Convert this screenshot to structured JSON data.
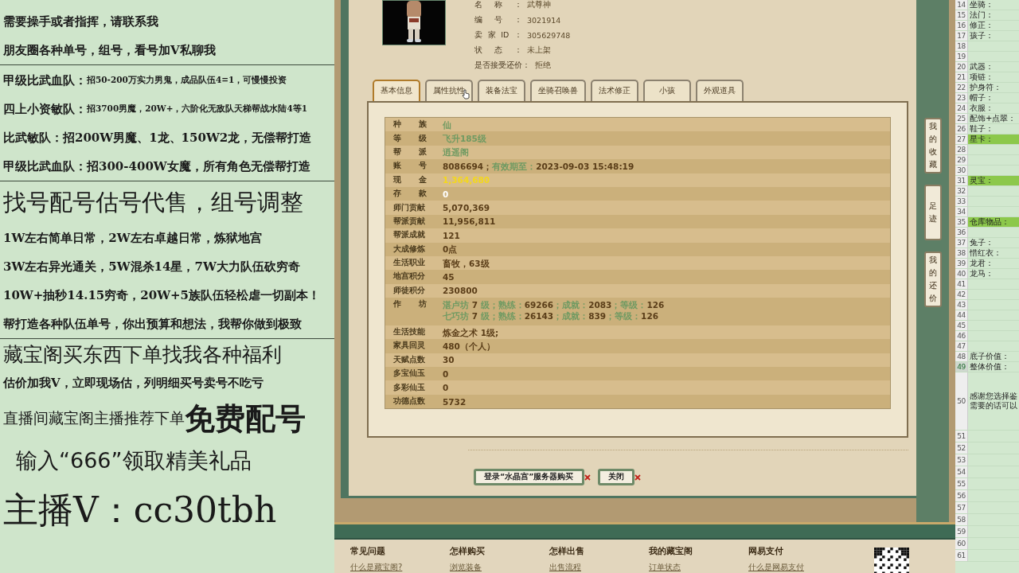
{
  "left_panel": {
    "lines": [
      {
        "kind": "line",
        "text": "需要操手或者指挥，请联系我"
      },
      {
        "kind": "line",
        "text": "朋友圈各种单号，组号，看号加V私聊我"
      },
      {
        "kind": "divider"
      },
      {
        "kind": "split",
        "label": "甲级比武血队：",
        "text": "招50-200万实力男鬼，成品队伍4=1，可慢慢投资"
      },
      {
        "kind": "split",
        "label": "四上小资敏队：",
        "text": "招3700男魔，20W+，六阶化无敌队天梯帮战水陆4等1"
      },
      {
        "kind": "line",
        "text": "比武敏队：招200W男魔、1龙、150W2龙，无偿帮打造"
      },
      {
        "kind": "line",
        "text": "甲级比武血队：招300-400W女魔，所有角色无偿帮打造"
      },
      {
        "kind": "divider"
      },
      {
        "kind": "headline",
        "text": "找号配号估号代售，组号调整"
      },
      {
        "kind": "line",
        "text": "1W左右简单日常，2W左右卓越日常，炼狱地宫"
      },
      {
        "kind": "line",
        "text": "3W左右异光通关，5W混杀14星，7W大力队伍砍穷奇"
      },
      {
        "kind": "line",
        "text": "10W+抽秒14.15穷奇，20W+5族队伍轻松虐一切副本！"
      },
      {
        "kind": "line",
        "text": "帮打造各种队伍单号，你出预算和想法，我帮你做到极致"
      },
      {
        "kind": "divider"
      },
      {
        "kind": "subhead",
        "text": "藏宝阁买东西下单找我各种福利"
      },
      {
        "kind": "line",
        "text": "估价加我V，立即现场估，列明细买号卖号不吃亏"
      },
      {
        "kind": "promo",
        "text": "直播间藏宝阁主播推荐下单",
        "suffix": "免费配号"
      },
      {
        "kind": "gift",
        "text": "输入“666”领取精美礼品"
      },
      {
        "kind": "contact",
        "text": "主播V：cc30tbh"
      }
    ]
  },
  "item": {
    "info": [
      {
        "label": "名称：",
        "value": "武尊神"
      },
      {
        "label": "编号：",
        "value": "3021914"
      },
      {
        "label": "卖家ID：",
        "value": "305629748"
      },
      {
        "label": "状态：",
        "value": "未上架"
      },
      {
        "label": "是否接受还价：",
        "value": "拒绝"
      }
    ],
    "tabs": [
      {
        "label": "基本信息",
        "selected": true
      },
      {
        "label": "属性抗性",
        "selected": false
      },
      {
        "label": "装备法宝",
        "selected": false
      },
      {
        "label": "坐骑召唤兽",
        "selected": false
      },
      {
        "label": "法术修正",
        "selected": false
      },
      {
        "label": "小孩",
        "selected": false
      },
      {
        "label": "外观道具",
        "selected": false
      }
    ],
    "details": [
      {
        "label": "种族",
        "lines": [
          [
            {
              "color": "#6f9a62",
              "text": "仙"
            }
          ]
        ]
      },
      {
        "label": "等级",
        "lines": [
          [
            {
              "color": "#6f9a62",
              "text": "飞升185级"
            }
          ]
        ]
      },
      {
        "label": "帮派",
        "lines": [
          [
            {
              "color": "#6f9a62",
              "text": "逍遥阁"
            }
          ]
        ]
      },
      {
        "label": "账号",
        "lines": [
          [
            {
              "color": "#5a3d18",
              "text": "8086694；"
            },
            {
              "color": "#6f9a62",
              "text": "有效期至："
            },
            {
              "color": "#5a3d18",
              "text": "2023-09-03 15:48:19"
            }
          ]
        ]
      },
      {
        "label": "现金",
        "lines": [
          [
            {
              "color": "#f4d81c",
              "text": "1,364,680"
            }
          ]
        ]
      },
      {
        "label": "存款",
        "lines": [
          [
            {
              "color": "#ffffff",
              "text": "0"
            }
          ]
        ]
      },
      {
        "label": "师门贡献",
        "lines": [
          [
            {
              "color": "#5a3d18",
              "text": "5,070,369"
            }
          ]
        ]
      },
      {
        "label": "帮派贡献",
        "lines": [
          [
            {
              "color": "#5a3d18",
              "text": "11,956,811"
            }
          ]
        ]
      },
      {
        "label": "帮派成就",
        "lines": [
          [
            {
              "color": "#5a3d18",
              "text": "121"
            }
          ]
        ]
      },
      {
        "label": "大成修炼",
        "lines": [
          [
            {
              "color": "#5a3d18",
              "text": "0点"
            }
          ]
        ]
      },
      {
        "label": "生活职业",
        "lines": [
          [
            {
              "color": "#5a3d18",
              "text": "畜牧，63级"
            }
          ]
        ]
      },
      {
        "label": "地宫积分",
        "lines": [
          [
            {
              "color": "#5a3d18",
              "text": "45"
            }
          ]
        ]
      },
      {
        "label": "师徒积分",
        "lines": [
          [
            {
              "color": "#5a3d18",
              "text": "230800"
            }
          ]
        ]
      },
      {
        "label": "作坊",
        "lines": [
          [
            {
              "color": "#6f9a62",
              "text": "湛卢坊 "
            },
            {
              "color": "#5a3d18",
              "text": "7"
            },
            {
              "color": "#6f9a62",
              "text": " 级；熟练："
            },
            {
              "color": "#5a3d18",
              "text": "69266"
            },
            {
              "color": "#6f9a62",
              "text": "；成就："
            },
            {
              "color": "#5a3d18",
              "text": "2083"
            },
            {
              "color": "#6f9a62",
              "text": "；等级："
            },
            {
              "color": "#5a3d18",
              "text": "126"
            }
          ],
          [
            {
              "color": "#6f9a62",
              "text": "七巧坊 "
            },
            {
              "color": "#5a3d18",
              "text": "7"
            },
            {
              "color": "#6f9a62",
              "text": " 级；熟练："
            },
            {
              "color": "#5a3d18",
              "text": "26143"
            },
            {
              "color": "#6f9a62",
              "text": "；成就："
            },
            {
              "color": "#5a3d18",
              "text": "839"
            },
            {
              "color": "#6f9a62",
              "text": "；等级："
            },
            {
              "color": "#5a3d18",
              "text": "126"
            }
          ]
        ]
      },
      {
        "label": "生活技能",
        "lines": [
          [
            {
              "color": "#5a3d18",
              "text": "炼金之术 1级;"
            }
          ]
        ]
      },
      {
        "label": "家具回灵",
        "lines": [
          [
            {
              "color": "#5a3d18",
              "text": "480（个人）"
            }
          ]
        ]
      },
      {
        "label": "天赋点数",
        "lines": [
          [
            {
              "color": "#5a3d18",
              "text": "30"
            }
          ]
        ]
      },
      {
        "label": "多宝仙玉",
        "lines": [
          [
            {
              "color": "#5a3d18",
              "text": "0"
            }
          ]
        ]
      },
      {
        "label": "多彩仙玉",
        "lines": [
          [
            {
              "color": "#5a3d18",
              "text": "0"
            }
          ]
        ]
      },
      {
        "label": "功德点数",
        "lines": [
          [
            {
              "color": "#5a3d18",
              "text": "5732"
            }
          ]
        ]
      }
    ],
    "buttons": [
      "登录“水晶宫”服务器购买",
      "关闭"
    ]
  },
  "side_tabs": [
    "我的收藏",
    "足迹",
    "我的还价"
  ],
  "footer": {
    "columns": [
      {
        "heading": "常见问题",
        "link": "什么是藏宝阁?"
      },
      {
        "heading": "怎样购买",
        "link": "浏览装备"
      },
      {
        "heading": "怎样出售",
        "link": "出售流程"
      },
      {
        "heading": "我的藏宝阁",
        "link": "订单状态"
      },
      {
        "heading": "网易支付",
        "link": "什么是网易支付"
      }
    ]
  },
  "sheet": {
    "rows": [
      {
        "kind": "short",
        "number": "14",
        "text": "坐骑：",
        "highlight": false,
        "selected": false
      },
      {
        "kind": "short",
        "number": "15",
        "text": "法门：",
        "highlight": false,
        "selected": false
      },
      {
        "kind": "short",
        "number": "16",
        "text": "修正：",
        "highlight": false,
        "selected": false
      },
      {
        "kind": "short",
        "number": "17",
        "text": "孩子：",
        "highlight": false,
        "selected": false
      },
      {
        "kind": "short",
        "number": "18",
        "highlight": false,
        "selected": false
      },
      {
        "kind": "short",
        "number": "19",
        "highlight": false,
        "selected": false
      },
      {
        "kind": "short",
        "number": "20",
        "text": "武器：",
        "highlight": false,
        "selected": false
      },
      {
        "kind": "short",
        "number": "21",
        "text": "项链：",
        "highlight": false,
        "selected": false
      },
      {
        "kind": "short",
        "number": "22",
        "text": "护身符：",
        "highlight": false,
        "selected": false
      },
      {
        "kind": "short",
        "number": "23",
        "text": "帽子：",
        "highlight": false,
        "selected": false
      },
      {
        "kind": "short",
        "number": "24",
        "text": "衣服：",
        "highlight": false,
        "selected": false
      },
      {
        "kind": "short",
        "number": "25",
        "text": "配饰+点翠：",
        "highlight": false,
        "selected": false
      },
      {
        "kind": "short",
        "number": "26",
        "text": "鞋子：",
        "highlight": false,
        "selected": false
      },
      {
        "kind": "short",
        "number": "27",
        "text": "星卡：",
        "highlight": true,
        "selected": false
      },
      {
        "kind": "short",
        "number": "28",
        "highlight": false,
        "selected": false
      },
      {
        "kind": "short",
        "number": "29",
        "highlight": false,
        "selected": false
      },
      {
        "kind": "short",
        "number": "30",
        "highlight": false,
        "selected": false
      },
      {
        "kind": "short",
        "number": "31",
        "text": "灵宝：",
        "highlight": true,
        "selected": false
      },
      {
        "kind": "short",
        "number": "32",
        "highlight": false,
        "selected": false
      },
      {
        "kind": "short",
        "number": "33",
        "highlight": false,
        "selected": false
      },
      {
        "kind": "short",
        "number": "34",
        "highlight": false,
        "selected": false
      },
      {
        "kind": "short",
        "number": "35",
        "text": "仓库物品：",
        "highlight": true,
        "selected": false
      },
      {
        "kind": "short",
        "number": "36",
        "highlight": false,
        "selected": false
      },
      {
        "kind": "short",
        "number": "37",
        "text": "兔子：",
        "highlight": false,
        "selected": false
      },
      {
        "kind": "short",
        "number": "38",
        "text": "惜红衣：",
        "highlight": false,
        "selected": false
      },
      {
        "kind": "short",
        "number": "39",
        "text": "龙君：",
        "highlight": false,
        "selected": false
      },
      {
        "kind": "short",
        "number": "40",
        "text": "龙马：",
        "highlight": false,
        "selected": false
      },
      {
        "kind": "short",
        "number": "41",
        "highlight": false,
        "selected": false
      },
      {
        "kind": "short",
        "number": "42",
        "highlight": false,
        "selected": false
      },
      {
        "kind": "short",
        "number": "43",
        "highlight": false,
        "selected": false
      },
      {
        "kind": "short",
        "number": "44",
        "highlight": false,
        "selected": false
      },
      {
        "kind": "short",
        "number": "45",
        "highlight": false,
        "selected": false
      },
      {
        "kind": "short",
        "number": "46",
        "highlight": false,
        "selected": false
      },
      {
        "kind": "short",
        "number": "47",
        "highlight": false,
        "selected": false
      },
      {
        "kind": "short",
        "number": "48",
        "text": "底子价值：",
        "highlight": false,
        "selected": false
      },
      {
        "kind": "short",
        "number": "49",
        "text": "整体价值：",
        "highlight": false,
        "selected": true
      },
      {
        "kind": "tall",
        "number": "50",
        "lines": [
          "感谢您选择鉴",
          "需要的话可以"
        ],
        "highlight": false,
        "selected": false
      },
      {
        "kind": "medium",
        "number": "51",
        "highlight": false,
        "selected": false
      },
      {
        "kind": "medium",
        "number": "52",
        "highlight": false,
        "selected": false
      },
      {
        "kind": "medium",
        "number": "53",
        "highlight": false,
        "selected": false
      },
      {
        "kind": "medium",
        "number": "54",
        "highlight": false,
        "selected": false
      },
      {
        "kind": "medium",
        "number": "55",
        "highlight": false,
        "selected": false
      },
      {
        "kind": "medium",
        "number": "56",
        "highlight": false,
        "selected": false
      },
      {
        "kind": "medium",
        "number": "57",
        "highlight": false,
        "selected": false
      },
      {
        "kind": "medium",
        "number": "58",
        "highlight": false,
        "selected": false
      },
      {
        "kind": "medium",
        "number": "59",
        "highlight": false,
        "selected": false
      },
      {
        "kind": "medium",
        "number": "60",
        "highlight": false,
        "selected": false
      },
      {
        "kind": "medium",
        "number": "61",
        "highlight": false,
        "selected": false
      }
    ]
  }
}
